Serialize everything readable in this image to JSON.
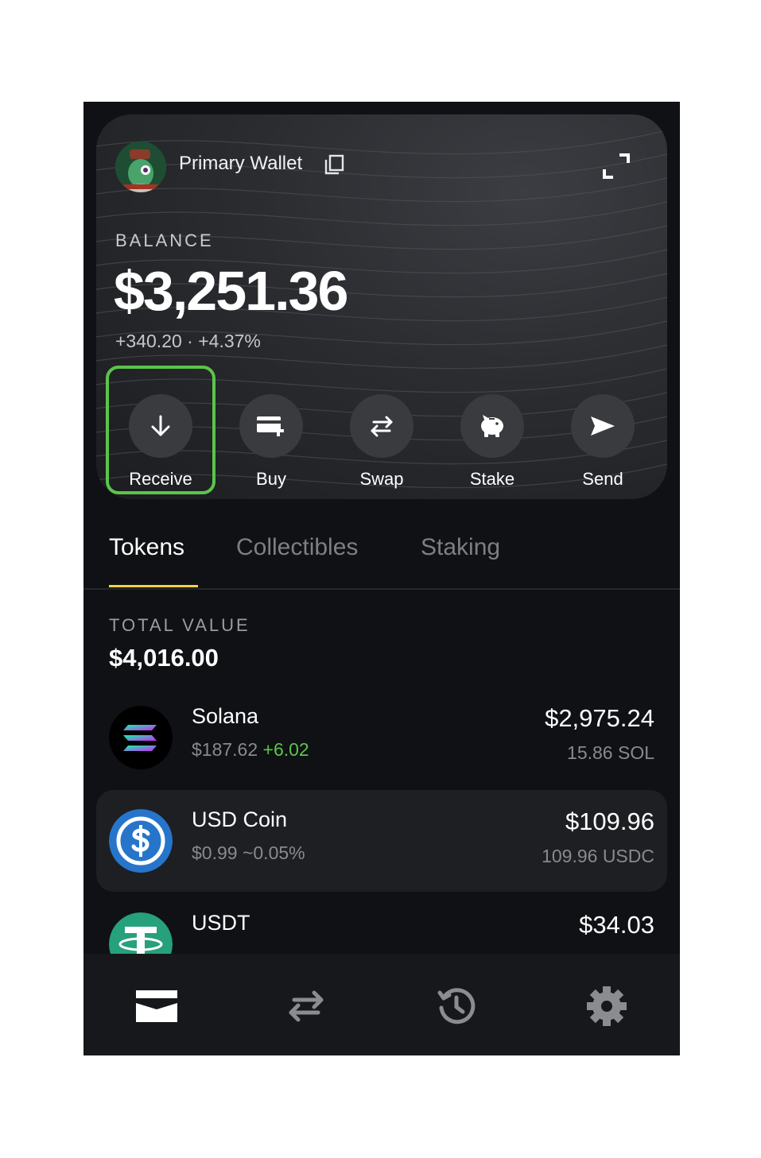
{
  "header": {
    "wallet_name": "Primary Wallet",
    "balance_label": "BALANCE",
    "balance": "$3,251.36",
    "change": "+340.20 · +4.37%"
  },
  "actions": [
    {
      "label": "Receive",
      "icon": "arrow-down-icon"
    },
    {
      "label": "Buy",
      "icon": "card-plus-icon"
    },
    {
      "label": "Swap",
      "icon": "swap-icon"
    },
    {
      "label": "Stake",
      "icon": "piggy-bank-icon"
    },
    {
      "label": "Send",
      "icon": "send-icon"
    }
  ],
  "tabs": [
    {
      "label": "Tokens",
      "active": true
    },
    {
      "label": "Collectibles",
      "active": false
    },
    {
      "label": "Staking",
      "active": false
    }
  ],
  "portfolio": {
    "total_label": "TOTAL VALUE",
    "total_value": "$4,016.00"
  },
  "tokens": [
    {
      "name": "Solana",
      "price": "$187.62",
      "change": "+6.02",
      "value": "$2,975.24",
      "amount": "15.86 SOL"
    },
    {
      "name": "USD Coin",
      "price": "$0.99",
      "change": "~0.05%",
      "value": "$109.96",
      "amount": "109.96 USDC"
    },
    {
      "name": "USDT",
      "price": "",
      "change": "",
      "value": "$34.03",
      "amount": ""
    }
  ],
  "nav": [
    "wallet-icon",
    "swap-icon",
    "history-icon",
    "settings-icon"
  ],
  "colors": {
    "accent_green": "#5cc44a",
    "tab_underline": "#f3d34a",
    "background": "#0f1114",
    "usdc_blue": "#2775ca",
    "usdt_green": "#26a17b"
  }
}
